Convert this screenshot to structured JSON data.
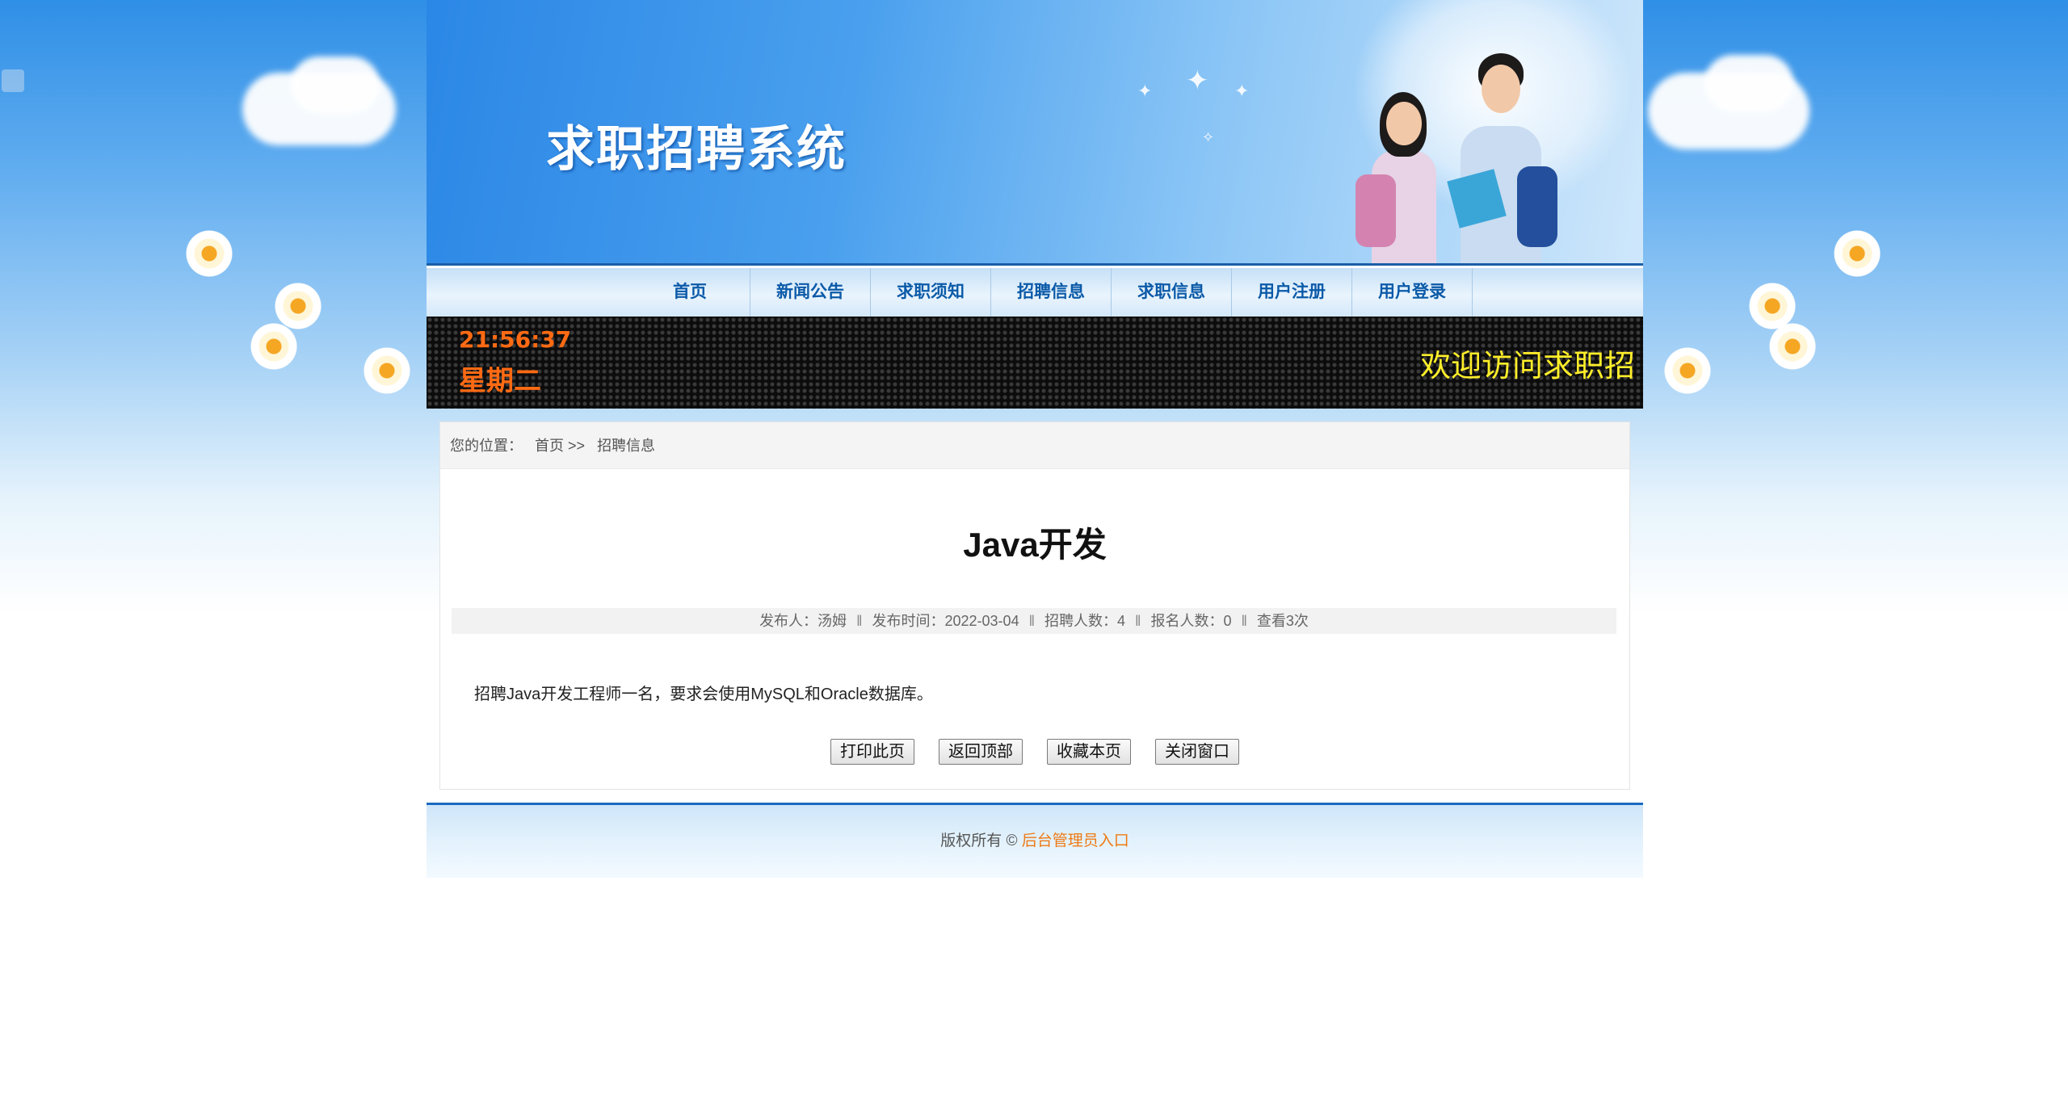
{
  "site": {
    "title": "求职招聘系统"
  },
  "nav": {
    "items": [
      {
        "label": "首页"
      },
      {
        "label": "新闻公告"
      },
      {
        "label": "求职须知"
      },
      {
        "label": "招聘信息"
      },
      {
        "label": "求职信息"
      },
      {
        "label": "用户注册"
      },
      {
        "label": "用户登录"
      }
    ]
  },
  "led": {
    "time": "21:56:37",
    "weekday": "星期二",
    "marquee": "欢迎访问求职招"
  },
  "breadcrumb": {
    "prefix": "您的位置：",
    "home": "首页 >>",
    "current": "招聘信息"
  },
  "article": {
    "title": "Java开发",
    "publisher_label": "发布人：汤姆",
    "date_label": "发布时间：2022-03-04",
    "hire_count_label": "招聘人数：4",
    "applied_label": "报名人数：0",
    "views_label": "查看3次",
    "separator": "‖",
    "body": "招聘Java开发工程师一名，要求会使用MySQL和Oracle数据库。"
  },
  "buttons": {
    "print": "打印此页",
    "top": "返回顶部",
    "favorite": "收藏本页",
    "close": "关闭窗口"
  },
  "footer": {
    "copyright": "版权所有 © ",
    "admin_link": "后台管理员入口"
  },
  "colors": {
    "nav_text": "#0b5aa8",
    "led_orange": "#ff6a13",
    "led_yellow": "#ffee2a",
    "footer_link": "#ee7a14"
  }
}
